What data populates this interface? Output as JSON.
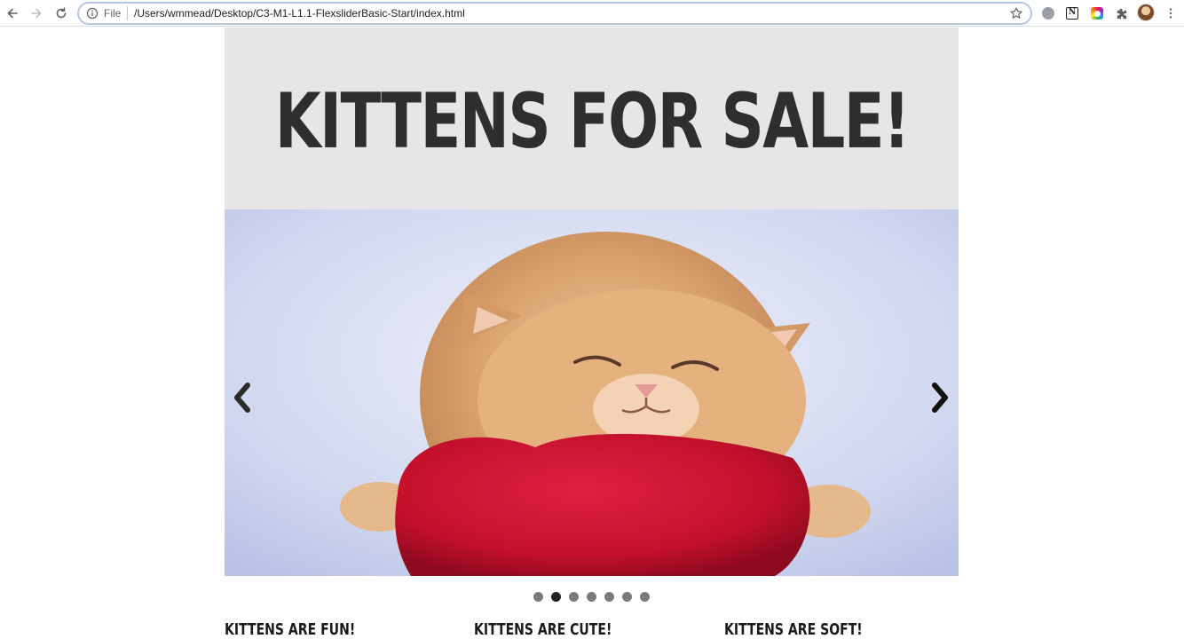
{
  "browser": {
    "scheme_label": "File",
    "url": "/Users/wmmead/Desktop/C3-M1-L1.1-FlexsliderBasic-Start/index.html"
  },
  "page": {
    "heading": "KITTENS FOR SALE!",
    "slider": {
      "slide_count": 7,
      "active_index": 1,
      "prev_symbol": "‹",
      "next_symbol": "›"
    },
    "features": [
      {
        "title": "KITTENS ARE FUN!"
      },
      {
        "title": "KITTENS ARE CUTE!"
      },
      {
        "title": "KITTENS ARE SOFT!"
      }
    ]
  },
  "colors": {
    "header_bg": "#e6e6e6",
    "heading_text": "#2e2e2e",
    "dot_active": "#222222",
    "dot_inactive": "#7a7a7a"
  }
}
